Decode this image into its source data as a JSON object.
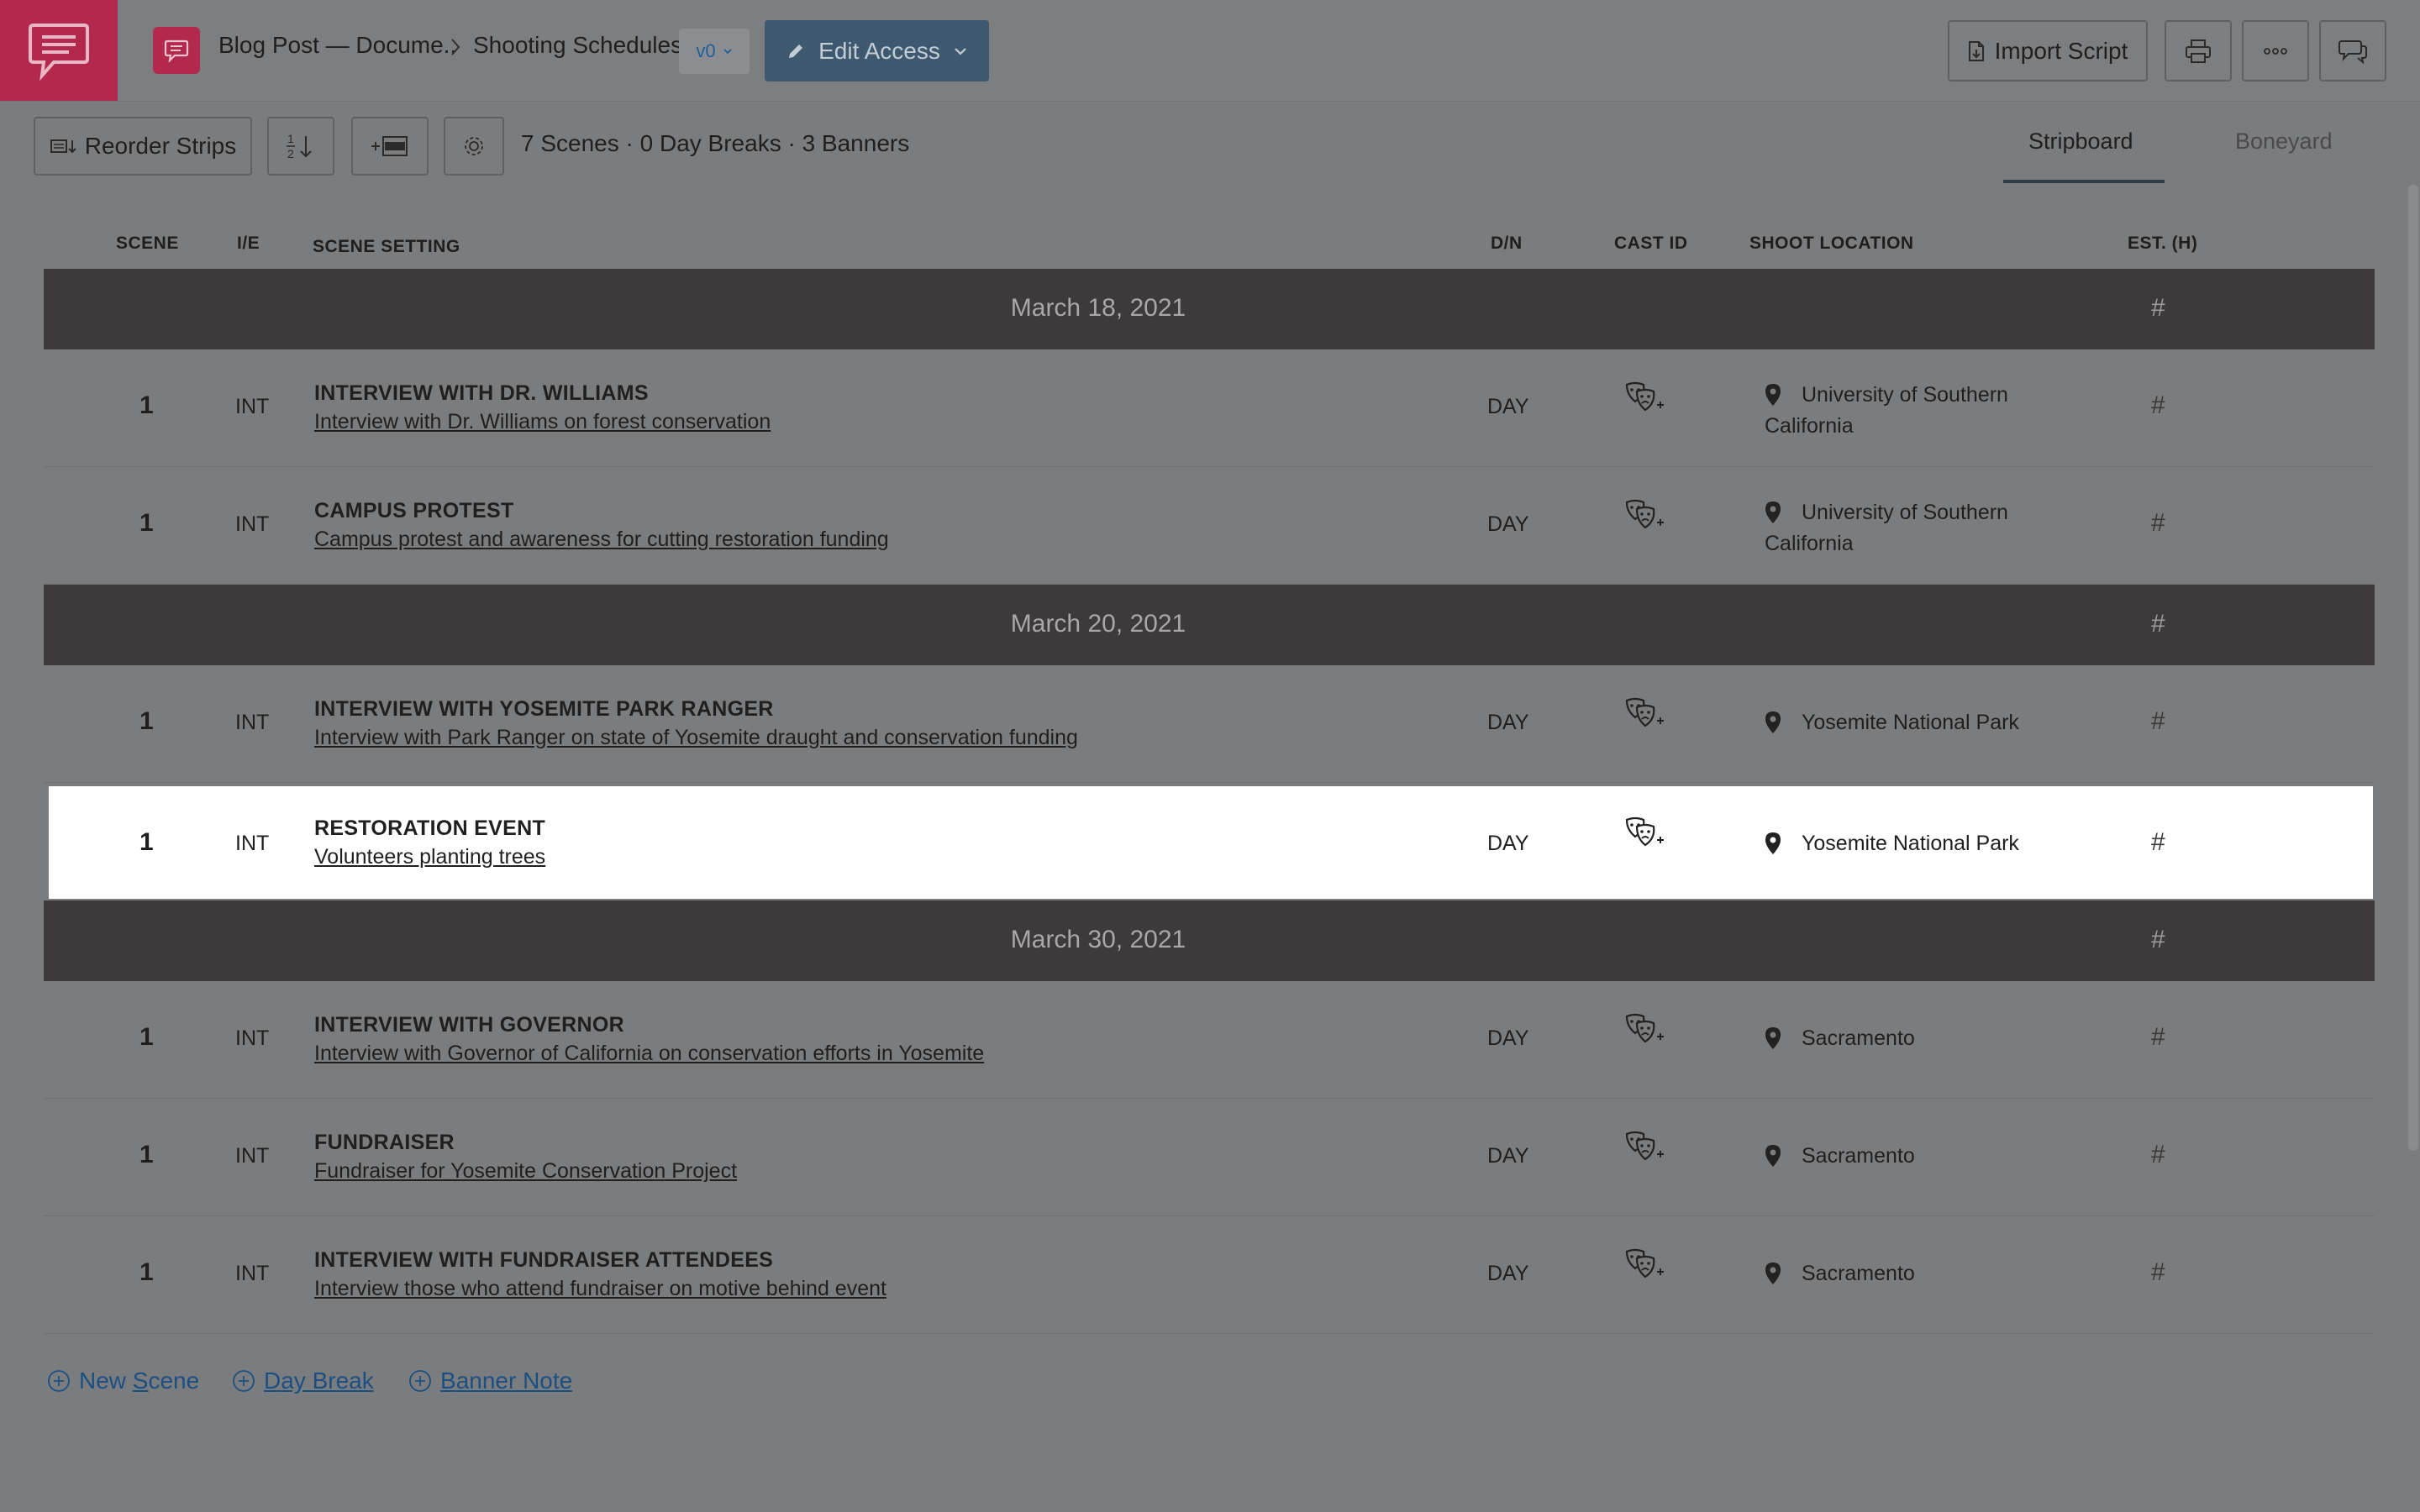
{
  "header": {
    "breadcrumb_project": "Blog Post — Docume..",
    "breadcrumb_page": "Shooting Schedules",
    "version": "v0",
    "edit_access_label": "Edit Access",
    "import_script_label": "Import Script"
  },
  "toolbar": {
    "reorder_label": "Reorder Strips",
    "summary": "7 Scenes · 0 Day Breaks · 3 Banners",
    "tabs": [
      {
        "label": "Stripboard",
        "active": true
      },
      {
        "label": "Boneyard",
        "active": false
      }
    ]
  },
  "columns": {
    "scene": "SCENE",
    "ie": "I/E",
    "setting": "SCENE SETTING",
    "dn": "D/N",
    "cast": "CAST ID",
    "location": "SHOOT LOCATION",
    "est": "EST. (H)"
  },
  "banners": [
    {
      "date": "March 18, 2021",
      "est": "#"
    },
    {
      "date": "March 20, 2021",
      "est": "#"
    },
    {
      "date": "March 30, 2021",
      "est": "#"
    }
  ],
  "scenes": [
    {
      "scene": "1",
      "ie": "INT",
      "title": "INTERVIEW WITH DR. WILLIAMS",
      "description": "Interview with Dr. Williams on forest conservation",
      "dn": "DAY",
      "location": "University of Southern California",
      "est": "#"
    },
    {
      "scene": "1",
      "ie": "INT",
      "title": "CAMPUS PROTEST",
      "description": "Campus protest and awareness for cutting restoration funding",
      "dn": "DAY",
      "location": "University of Southern California",
      "est": "#"
    },
    {
      "scene": "1",
      "ie": "INT",
      "title": "INTERVIEW WITH YOSEMITE PARK RANGER",
      "description": "Interview with Park Ranger on state of Yosemite draught and conservation funding",
      "dn": "DAY",
      "location": "Yosemite National Park",
      "est": "#"
    },
    {
      "scene": "1",
      "ie": "INT",
      "title": "RESTORATION EVENT",
      "description": "Volunteers planting trees ",
      "dn": "DAY",
      "location": "Yosemite National Park",
      "est": "#"
    },
    {
      "scene": "1",
      "ie": "INT",
      "title": "INTERVIEW WITH GOVERNOR",
      "description": "Interview with Governor of California on conservation efforts in Yosemite",
      "dn": "DAY",
      "location": "Sacramento",
      "est": "#"
    },
    {
      "scene": "1",
      "ie": "INT",
      "title": "FUNDRAISER",
      "description": "Fundraiser for Yosemite Conservation Project",
      "dn": "DAY",
      "location": "Sacramento",
      "est": "#"
    },
    {
      "scene": "1",
      "ie": "INT",
      "title": "INTERVIEW WITH FUNDRAISER ATTENDEES",
      "description": "Interview those who attend fundraiser on motive behind event",
      "dn": "DAY",
      "location": "Sacramento",
      "est": "#"
    }
  ],
  "footer": {
    "new_scene_pre": "New ",
    "new_scene_u": "S",
    "new_scene_post": "cene",
    "day_break_u": "D",
    "day_break_post": "ay Break",
    "banner_note_u": "B",
    "banner_note_post": "anner Note"
  },
  "colors": {
    "brand": "#b2294d",
    "banner_bg": "#3e393a",
    "edit_access_bg": "#3e5870",
    "link": "#1a4f84",
    "highlight_row": "#ffffff"
  },
  "icons": [
    "studiobinder-logo-icon",
    "document-icon",
    "chevron-right-icon",
    "chevron-down-icon",
    "pencil-icon",
    "file-icon",
    "print-icon",
    "more-icon",
    "comments-icon",
    "sort-icon",
    "add-banner-icon",
    "settings-icon",
    "cast-masks-icon",
    "location-pin-icon",
    "plus-circle-icon"
  ]
}
